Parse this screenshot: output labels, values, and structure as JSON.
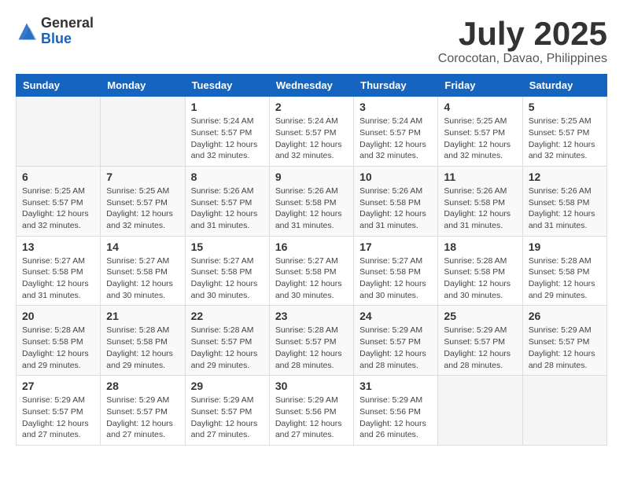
{
  "logo": {
    "general": "General",
    "blue": "Blue"
  },
  "title": "July 2025",
  "subtitle": "Corocotan, Davao, Philippines",
  "weekdays": [
    "Sunday",
    "Monday",
    "Tuesday",
    "Wednesday",
    "Thursday",
    "Friday",
    "Saturday"
  ],
  "weeks": [
    [
      {
        "day": "",
        "sunrise": "",
        "sunset": "",
        "daylight": ""
      },
      {
        "day": "",
        "sunrise": "",
        "sunset": "",
        "daylight": ""
      },
      {
        "day": "1",
        "sunrise": "Sunrise: 5:24 AM",
        "sunset": "Sunset: 5:57 PM",
        "daylight": "Daylight: 12 hours and 32 minutes."
      },
      {
        "day": "2",
        "sunrise": "Sunrise: 5:24 AM",
        "sunset": "Sunset: 5:57 PM",
        "daylight": "Daylight: 12 hours and 32 minutes."
      },
      {
        "day": "3",
        "sunrise": "Sunrise: 5:24 AM",
        "sunset": "Sunset: 5:57 PM",
        "daylight": "Daylight: 12 hours and 32 minutes."
      },
      {
        "day": "4",
        "sunrise": "Sunrise: 5:25 AM",
        "sunset": "Sunset: 5:57 PM",
        "daylight": "Daylight: 12 hours and 32 minutes."
      },
      {
        "day": "5",
        "sunrise": "Sunrise: 5:25 AM",
        "sunset": "Sunset: 5:57 PM",
        "daylight": "Daylight: 12 hours and 32 minutes."
      }
    ],
    [
      {
        "day": "6",
        "sunrise": "Sunrise: 5:25 AM",
        "sunset": "Sunset: 5:57 PM",
        "daylight": "Daylight: 12 hours and 32 minutes."
      },
      {
        "day": "7",
        "sunrise": "Sunrise: 5:25 AM",
        "sunset": "Sunset: 5:57 PM",
        "daylight": "Daylight: 12 hours and 32 minutes."
      },
      {
        "day": "8",
        "sunrise": "Sunrise: 5:26 AM",
        "sunset": "Sunset: 5:57 PM",
        "daylight": "Daylight: 12 hours and 31 minutes."
      },
      {
        "day": "9",
        "sunrise": "Sunrise: 5:26 AM",
        "sunset": "Sunset: 5:58 PM",
        "daylight": "Daylight: 12 hours and 31 minutes."
      },
      {
        "day": "10",
        "sunrise": "Sunrise: 5:26 AM",
        "sunset": "Sunset: 5:58 PM",
        "daylight": "Daylight: 12 hours and 31 minutes."
      },
      {
        "day": "11",
        "sunrise": "Sunrise: 5:26 AM",
        "sunset": "Sunset: 5:58 PM",
        "daylight": "Daylight: 12 hours and 31 minutes."
      },
      {
        "day": "12",
        "sunrise": "Sunrise: 5:26 AM",
        "sunset": "Sunset: 5:58 PM",
        "daylight": "Daylight: 12 hours and 31 minutes."
      }
    ],
    [
      {
        "day": "13",
        "sunrise": "Sunrise: 5:27 AM",
        "sunset": "Sunset: 5:58 PM",
        "daylight": "Daylight: 12 hours and 31 minutes."
      },
      {
        "day": "14",
        "sunrise": "Sunrise: 5:27 AM",
        "sunset": "Sunset: 5:58 PM",
        "daylight": "Daylight: 12 hours and 30 minutes."
      },
      {
        "day": "15",
        "sunrise": "Sunrise: 5:27 AM",
        "sunset": "Sunset: 5:58 PM",
        "daylight": "Daylight: 12 hours and 30 minutes."
      },
      {
        "day": "16",
        "sunrise": "Sunrise: 5:27 AM",
        "sunset": "Sunset: 5:58 PM",
        "daylight": "Daylight: 12 hours and 30 minutes."
      },
      {
        "day": "17",
        "sunrise": "Sunrise: 5:27 AM",
        "sunset": "Sunset: 5:58 PM",
        "daylight": "Daylight: 12 hours and 30 minutes."
      },
      {
        "day": "18",
        "sunrise": "Sunrise: 5:28 AM",
        "sunset": "Sunset: 5:58 PM",
        "daylight": "Daylight: 12 hours and 30 minutes."
      },
      {
        "day": "19",
        "sunrise": "Sunrise: 5:28 AM",
        "sunset": "Sunset: 5:58 PM",
        "daylight": "Daylight: 12 hours and 29 minutes."
      }
    ],
    [
      {
        "day": "20",
        "sunrise": "Sunrise: 5:28 AM",
        "sunset": "Sunset: 5:58 PM",
        "daylight": "Daylight: 12 hours and 29 minutes."
      },
      {
        "day": "21",
        "sunrise": "Sunrise: 5:28 AM",
        "sunset": "Sunset: 5:58 PM",
        "daylight": "Daylight: 12 hours and 29 minutes."
      },
      {
        "day": "22",
        "sunrise": "Sunrise: 5:28 AM",
        "sunset": "Sunset: 5:57 PM",
        "daylight": "Daylight: 12 hours and 29 minutes."
      },
      {
        "day": "23",
        "sunrise": "Sunrise: 5:28 AM",
        "sunset": "Sunset: 5:57 PM",
        "daylight": "Daylight: 12 hours and 28 minutes."
      },
      {
        "day": "24",
        "sunrise": "Sunrise: 5:29 AM",
        "sunset": "Sunset: 5:57 PM",
        "daylight": "Daylight: 12 hours and 28 minutes."
      },
      {
        "day": "25",
        "sunrise": "Sunrise: 5:29 AM",
        "sunset": "Sunset: 5:57 PM",
        "daylight": "Daylight: 12 hours and 28 minutes."
      },
      {
        "day": "26",
        "sunrise": "Sunrise: 5:29 AM",
        "sunset": "Sunset: 5:57 PM",
        "daylight": "Daylight: 12 hours and 28 minutes."
      }
    ],
    [
      {
        "day": "27",
        "sunrise": "Sunrise: 5:29 AM",
        "sunset": "Sunset: 5:57 PM",
        "daylight": "Daylight: 12 hours and 27 minutes."
      },
      {
        "day": "28",
        "sunrise": "Sunrise: 5:29 AM",
        "sunset": "Sunset: 5:57 PM",
        "daylight": "Daylight: 12 hours and 27 minutes."
      },
      {
        "day": "29",
        "sunrise": "Sunrise: 5:29 AM",
        "sunset": "Sunset: 5:57 PM",
        "daylight": "Daylight: 12 hours and 27 minutes."
      },
      {
        "day": "30",
        "sunrise": "Sunrise: 5:29 AM",
        "sunset": "Sunset: 5:56 PM",
        "daylight": "Daylight: 12 hours and 27 minutes."
      },
      {
        "day": "31",
        "sunrise": "Sunrise: 5:29 AM",
        "sunset": "Sunset: 5:56 PM",
        "daylight": "Daylight: 12 hours and 26 minutes."
      },
      {
        "day": "",
        "sunrise": "",
        "sunset": "",
        "daylight": ""
      },
      {
        "day": "",
        "sunrise": "",
        "sunset": "",
        "daylight": ""
      }
    ]
  ]
}
